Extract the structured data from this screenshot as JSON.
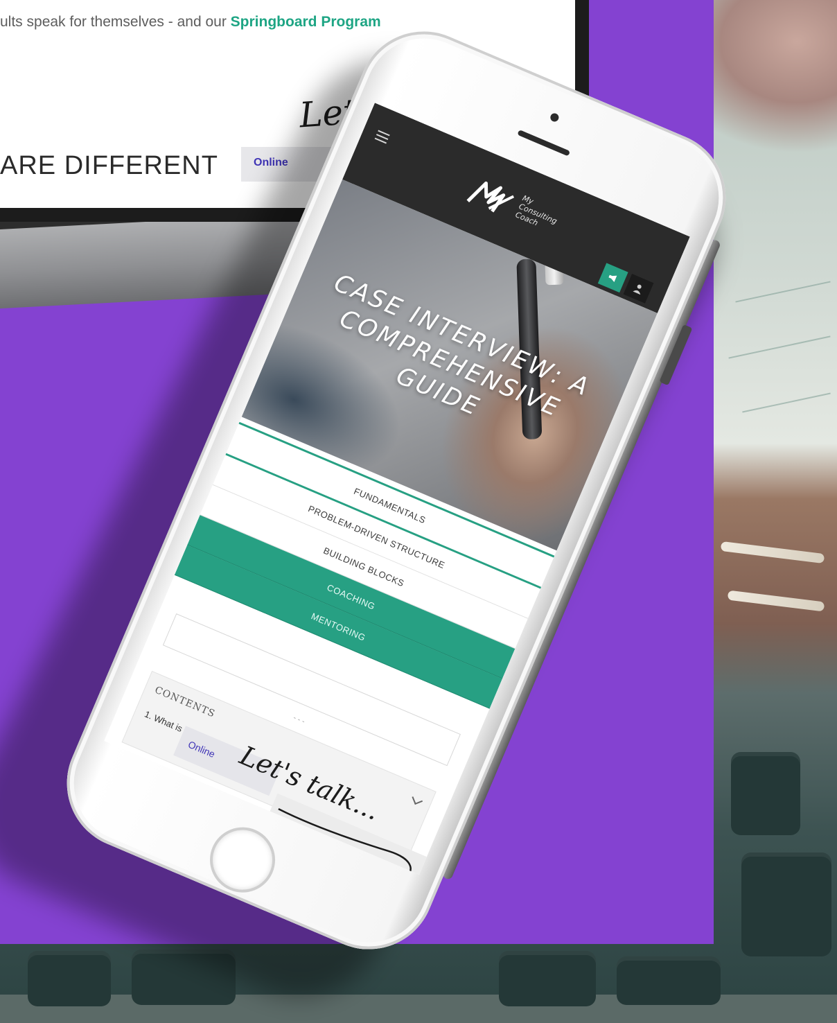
{
  "laptop": {
    "body_text_prefix": "ults speak for themselves - and our ",
    "body_link": "Springboard Program",
    "headline": "ARE DIFFERENT",
    "chat_script": "Let's t",
    "online_label": "Online"
  },
  "phone": {
    "logo_lines": [
      "My",
      "Consulting",
      "Coach"
    ],
    "hero_title_line1": "CASE INTERVIEW: A",
    "hero_title_line2": "COMPREHENSIVE GUIDE",
    "tabs": [
      {
        "label": "FUNDAMENTALS",
        "active": true
      },
      {
        "label": "PROBLEM-DRIVEN STRUCTURE"
      },
      {
        "label": "BUILDING BLOCKS"
      },
      {
        "label": "COACHING"
      },
      {
        "label": "MENTORING"
      }
    ],
    "divider": "- - -",
    "contents_label": "CONTENTS",
    "contents_item": "1. What is a c",
    "chat_prompt": "Let's talk...",
    "online_label": "Online"
  },
  "colors": {
    "purple": "#8442d1",
    "teal": "#27a083",
    "header_dark": "#2b2b2b",
    "link_green": "#1ea584",
    "online_blue": "#3f34b6"
  }
}
